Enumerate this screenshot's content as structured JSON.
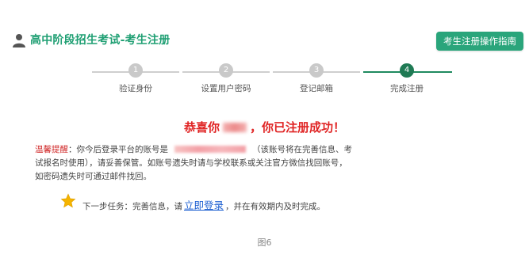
{
  "header": {
    "title": "高中阶段招生考试-考生注册",
    "guide_button": "考生注册操作指南",
    "accent_color": "#2aa57b",
    "user_icon": "user-icon"
  },
  "steps": [
    {
      "number": "1",
      "label": "验证身份",
      "state": "done"
    },
    {
      "number": "2",
      "label": "设置用户密码",
      "state": "done"
    },
    {
      "number": "3",
      "label": "登记邮箱",
      "state": "done"
    },
    {
      "number": "4",
      "label": "完成注册",
      "state": "current"
    }
  ],
  "success": {
    "prefix": "恭喜你",
    "suffix": "，你已注册成功！",
    "color": "#e02525"
  },
  "tip": {
    "label": "温馨提醒",
    "colon": "：",
    "part1": "你今后登录平台的账号是",
    "part2": "（该账号将在完善信息、考试报名时使用），请妥善保管。如账号遗失时请与学校联系或关注官方微信找回账号，如密码遗失时可通过邮件找回。"
  },
  "next_step": {
    "icon": "star-icon",
    "prefix": "下一步任务：完善信息，请",
    "link": "立即登录",
    "suffix": "，并在有效期内及时完成。"
  },
  "caption": "图6"
}
